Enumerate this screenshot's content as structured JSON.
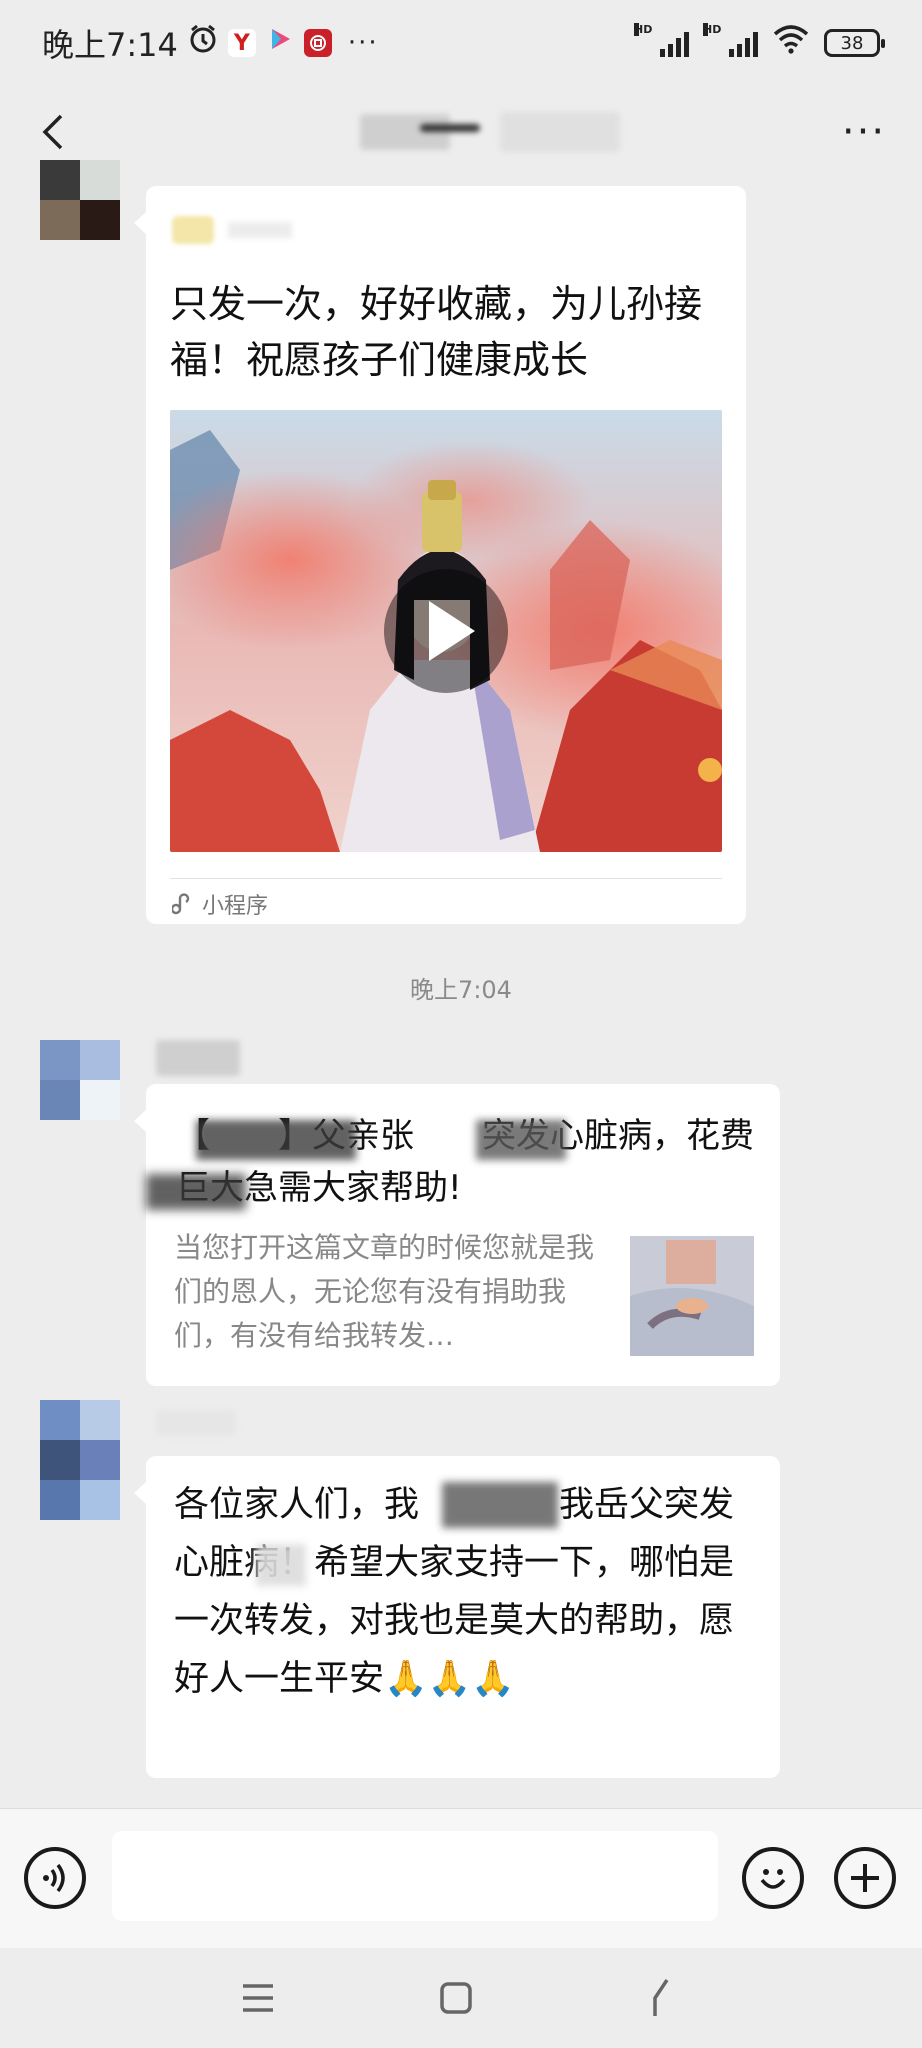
{
  "status_bar": {
    "time": "晚上7:14",
    "more": "···",
    "battery": "38",
    "hd1": "HD",
    "hd2": "HD"
  },
  "nav": {
    "back_icon": "chevron-left-icon",
    "more_icon": "ellipsis-icon",
    "more_label": "···"
  },
  "messages": {
    "m1": {
      "title": "只发一次，好好收藏，为儿孙接福！祝愿孩子们健康成长",
      "mini_program_label": "小程序"
    },
    "timestamp": "晚上7:04",
    "m2": {
      "title": "【　　】父亲张　　突发心脏病，花费巨大急需大家帮助!",
      "description": "当您打开这篇文章的时候您就是我们的恩人，无论您有没有捐助我们，有没有给我转发…"
    },
    "m3": {
      "text": "各位家人们，我　　　　我岳父突发心脏病！希望大家支持一下，哪怕是一次转发，对我也是莫大的帮助，愿好人一生平安🙏🙏🙏"
    }
  },
  "input_bar": {
    "voice_icon": "voice-icon",
    "emoji_icon": "emoji-icon",
    "plus_icon": "plus-icon",
    "placeholder": ""
  },
  "colors": {
    "background": "#ededed",
    "bubble": "#ffffff",
    "timestamp": "#8a8a8a"
  }
}
